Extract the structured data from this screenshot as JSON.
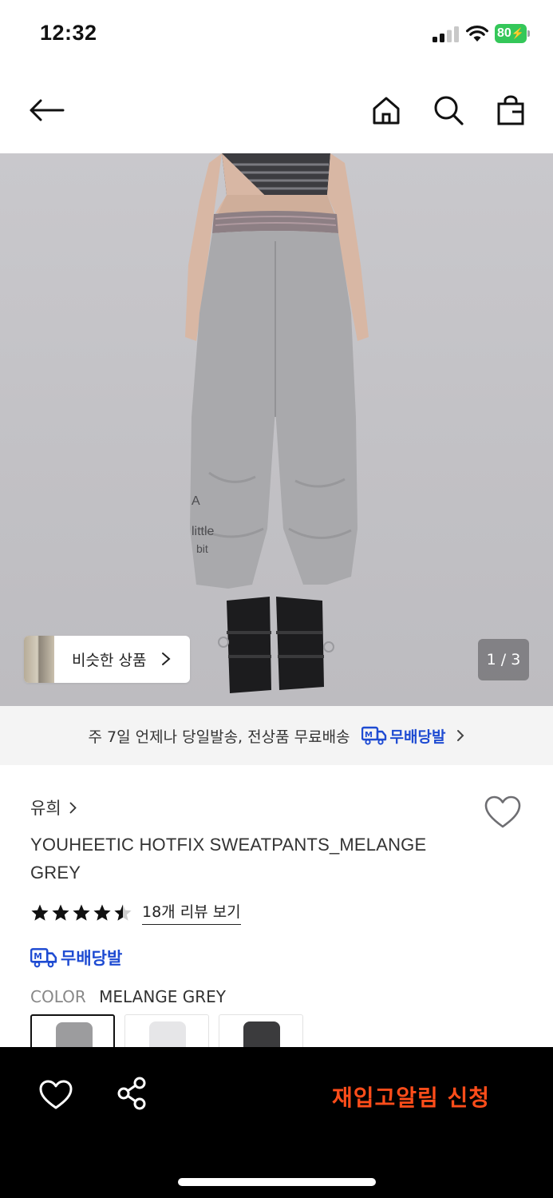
{
  "status_bar": {
    "time": "12:32",
    "battery": "80"
  },
  "nav": {
    "back_icon": "arrow-left-icon",
    "home_icon": "home-icon",
    "search_icon": "search-icon",
    "bag_icon": "shopping-bag-icon"
  },
  "hero": {
    "similar_label": "비슷한 상품",
    "page_indicator": "1 / 3"
  },
  "shipping_banner": {
    "text": "주 7일 언제나 당일발송, 전상품 무료배송",
    "badge_label": "무배당발"
  },
  "product": {
    "brand": "유희",
    "name": "YOUHEETIC HOTFIX SWEATPANTS_MELANGE GREY",
    "rating": 4.5,
    "review_link": "18개 리뷰 보기",
    "badge_label": "무배당발",
    "color_label": "COLOR",
    "color_value": "MELANGE GREY",
    "swatch_colors": [
      "#9c9c9e",
      "#e6e6e8",
      "#3b3b3d"
    ]
  },
  "bottom_bar": {
    "restock_label": "재입고알림 신청",
    "restock_color": "#ff4d1a"
  }
}
